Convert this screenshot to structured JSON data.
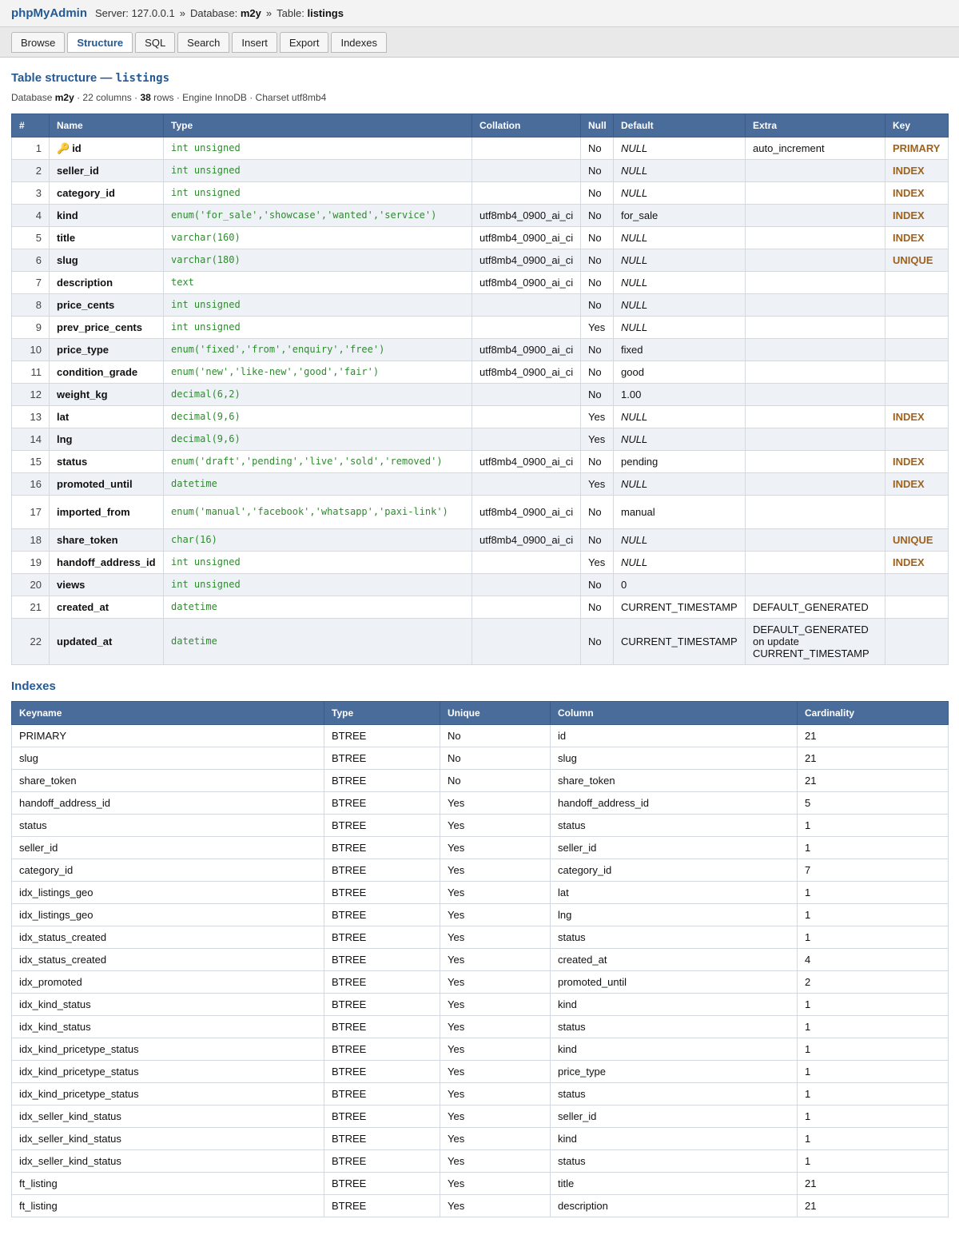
{
  "header": {
    "brand": "phpMyAdmin",
    "server_label": "Server:",
    "server": "127.0.0.1",
    "sep": "»",
    "database_label": "Database:",
    "database": "m2y",
    "table_label": "Table:",
    "table": "listings"
  },
  "tabs": [
    {
      "label": "Browse",
      "active": false
    },
    {
      "label": "Structure",
      "active": true
    },
    {
      "label": "SQL",
      "active": false
    },
    {
      "label": "Search",
      "active": false
    },
    {
      "label": "Insert",
      "active": false
    },
    {
      "label": "Export",
      "active": false
    },
    {
      "label": "Indexes",
      "active": false
    }
  ],
  "structure": {
    "title_prefix": "Table structure —",
    "table_name": "listings",
    "meta": {
      "db_label": "Database",
      "db": "m2y",
      "columns": "· 22 columns ·",
      "rows": "38",
      "rows_suffix": "rows · Engine InnoDB · Charset utf8mb4"
    },
    "headers": [
      "#",
      "Name",
      "Type",
      "Collation",
      "Null",
      "Default",
      "Extra",
      "Key"
    ],
    "rows": [
      {
        "n": "1",
        "name": "id",
        "primary_icon": true,
        "type": "int unsigned",
        "collation": "",
        "null": "No",
        "default": "NULL",
        "extra": "auto_increment",
        "key": "PRIMARY"
      },
      {
        "n": "2",
        "name": "seller_id",
        "type": "int unsigned",
        "collation": "",
        "null": "No",
        "default": "NULL",
        "extra": "",
        "key": "INDEX"
      },
      {
        "n": "3",
        "name": "category_id",
        "type": "int unsigned",
        "collation": "",
        "null": "No",
        "default": "NULL",
        "extra": "",
        "key": "INDEX"
      },
      {
        "n": "4",
        "name": "kind",
        "type": "enum('for_sale','showcase','wanted','service')",
        "collation": "utf8mb4_0900_ai_ci",
        "null": "No",
        "default": "for_sale",
        "extra": "",
        "key": "INDEX"
      },
      {
        "n": "5",
        "name": "title",
        "type": "varchar(160)",
        "collation": "utf8mb4_0900_ai_ci",
        "null": "No",
        "default": "NULL",
        "extra": "",
        "key": "INDEX"
      },
      {
        "n": "6",
        "name": "slug",
        "type": "varchar(180)",
        "collation": "utf8mb4_0900_ai_ci",
        "null": "No",
        "default": "NULL",
        "extra": "",
        "key": "UNIQUE"
      },
      {
        "n": "7",
        "name": "description",
        "type": "text",
        "collation": "utf8mb4_0900_ai_ci",
        "null": "No",
        "default": "NULL",
        "extra": "",
        "key": ""
      },
      {
        "n": "8",
        "name": "price_cents",
        "type": "int unsigned",
        "collation": "",
        "null": "No",
        "default": "NULL",
        "extra": "",
        "key": ""
      },
      {
        "n": "9",
        "name": "prev_price_cents",
        "type": "int unsigned",
        "collation": "",
        "null": "Yes",
        "default": "NULL",
        "extra": "",
        "key": ""
      },
      {
        "n": "10",
        "name": "price_type",
        "type": "enum('fixed','from','enquiry','free')",
        "collation": "utf8mb4_0900_ai_ci",
        "null": "No",
        "default": "fixed",
        "extra": "",
        "key": ""
      },
      {
        "n": "11",
        "name": "condition_grade",
        "type": "enum('new','like-new','good','fair')",
        "collation": "utf8mb4_0900_ai_ci",
        "null": "No",
        "default": "good",
        "extra": "",
        "key": ""
      },
      {
        "n": "12",
        "name": "weight_kg",
        "type": "decimal(6,2)",
        "collation": "",
        "null": "No",
        "default": "1.00",
        "extra": "",
        "key": ""
      },
      {
        "n": "13",
        "name": "lat",
        "type": "decimal(9,6)",
        "collation": "",
        "null": "Yes",
        "default": "NULL",
        "extra": "",
        "key": "INDEX"
      },
      {
        "n": "14",
        "name": "lng",
        "type": "decimal(9,6)",
        "collation": "",
        "null": "Yes",
        "default": "NULL",
        "extra": "",
        "key": ""
      },
      {
        "n": "15",
        "name": "status",
        "type": "enum('draft','pending','live','sold','removed')",
        "collation": "utf8mb4_0900_ai_ci",
        "null": "No",
        "default": "pending",
        "extra": "",
        "key": "INDEX"
      },
      {
        "n": "16",
        "name": "promoted_until",
        "type": "datetime",
        "collation": "",
        "null": "Yes",
        "default": "NULL",
        "extra": "",
        "key": "INDEX"
      },
      {
        "n": "17",
        "name": "imported_from",
        "type": "enum('manual','facebook','whatsapp','paxi-link')",
        "collation": "utf8mb4_0900_ai_ci",
        "null": "No",
        "default": "manual",
        "extra": "",
        "key": "",
        "tall": true
      },
      {
        "n": "18",
        "name": "share_token",
        "type": "char(16)",
        "collation": "utf8mb4_0900_ai_ci",
        "null": "No",
        "default": "NULL",
        "extra": "",
        "key": "UNIQUE"
      },
      {
        "n": "19",
        "name": "handoff_address_id",
        "type": "int unsigned",
        "collation": "",
        "null": "Yes",
        "default": "NULL",
        "extra": "",
        "key": "INDEX"
      },
      {
        "n": "20",
        "name": "views",
        "type": "int unsigned",
        "collation": "",
        "null": "No",
        "default": "0",
        "extra": "",
        "key": ""
      },
      {
        "n": "21",
        "name": "created_at",
        "type": "datetime",
        "collation": "",
        "null": "No",
        "default": "CURRENT_TIMESTAMP",
        "extra": "DEFAULT_GENERATED",
        "key": ""
      },
      {
        "n": "22",
        "name": "updated_at",
        "type": "datetime",
        "collation": "",
        "null": "No",
        "default": "CURRENT_TIMESTAMP",
        "extra": "DEFAULT_GENERATED on update CURRENT_TIMESTAMP",
        "key": "",
        "taller": true
      }
    ]
  },
  "indexes": {
    "title": "Indexes",
    "headers": [
      "Keyname",
      "Type",
      "Unique",
      "Column",
      "Cardinality"
    ],
    "rows": [
      [
        "PRIMARY",
        "BTREE",
        "No",
        "id",
        "21"
      ],
      [
        "slug",
        "BTREE",
        "No",
        "slug",
        "21"
      ],
      [
        "share_token",
        "BTREE",
        "No",
        "share_token",
        "21"
      ],
      [
        "handoff_address_id",
        "BTREE",
        "Yes",
        "handoff_address_id",
        "5"
      ],
      [
        "status",
        "BTREE",
        "Yes",
        "status",
        "1"
      ],
      [
        "seller_id",
        "BTREE",
        "Yes",
        "seller_id",
        "1"
      ],
      [
        "category_id",
        "BTREE",
        "Yes",
        "category_id",
        "7"
      ],
      [
        "idx_listings_geo",
        "BTREE",
        "Yes",
        "lat",
        "1"
      ],
      [
        "idx_listings_geo",
        "BTREE",
        "Yes",
        "lng",
        "1"
      ],
      [
        "idx_status_created",
        "BTREE",
        "Yes",
        "status",
        "1"
      ],
      [
        "idx_status_created",
        "BTREE",
        "Yes",
        "created_at",
        "4"
      ],
      [
        "idx_promoted",
        "BTREE",
        "Yes",
        "promoted_until",
        "2"
      ],
      [
        "idx_kind_status",
        "BTREE",
        "Yes",
        "kind",
        "1"
      ],
      [
        "idx_kind_status",
        "BTREE",
        "Yes",
        "status",
        "1"
      ],
      [
        "idx_kind_pricetype_status",
        "BTREE",
        "Yes",
        "kind",
        "1"
      ],
      [
        "idx_kind_pricetype_status",
        "BTREE",
        "Yes",
        "price_type",
        "1"
      ],
      [
        "idx_kind_pricetype_status",
        "BTREE",
        "Yes",
        "status",
        "1"
      ],
      [
        "idx_seller_kind_status",
        "BTREE",
        "Yes",
        "seller_id",
        "1"
      ],
      [
        "idx_seller_kind_status",
        "BTREE",
        "Yes",
        "kind",
        "1"
      ],
      [
        "idx_seller_kind_status",
        "BTREE",
        "Yes",
        "status",
        "1"
      ],
      [
        "ft_listing",
        "BTREE",
        "Yes",
        "title",
        "21"
      ],
      [
        "ft_listing",
        "BTREE",
        "Yes",
        "description",
        "21"
      ]
    ]
  },
  "colors": {
    "brand": "#235a96",
    "header_bg": "#4a6c9b",
    "type_text": "#2f8a2f",
    "key_text": "#a0621a"
  },
  "icons": {
    "primary_key": "key-icon"
  }
}
